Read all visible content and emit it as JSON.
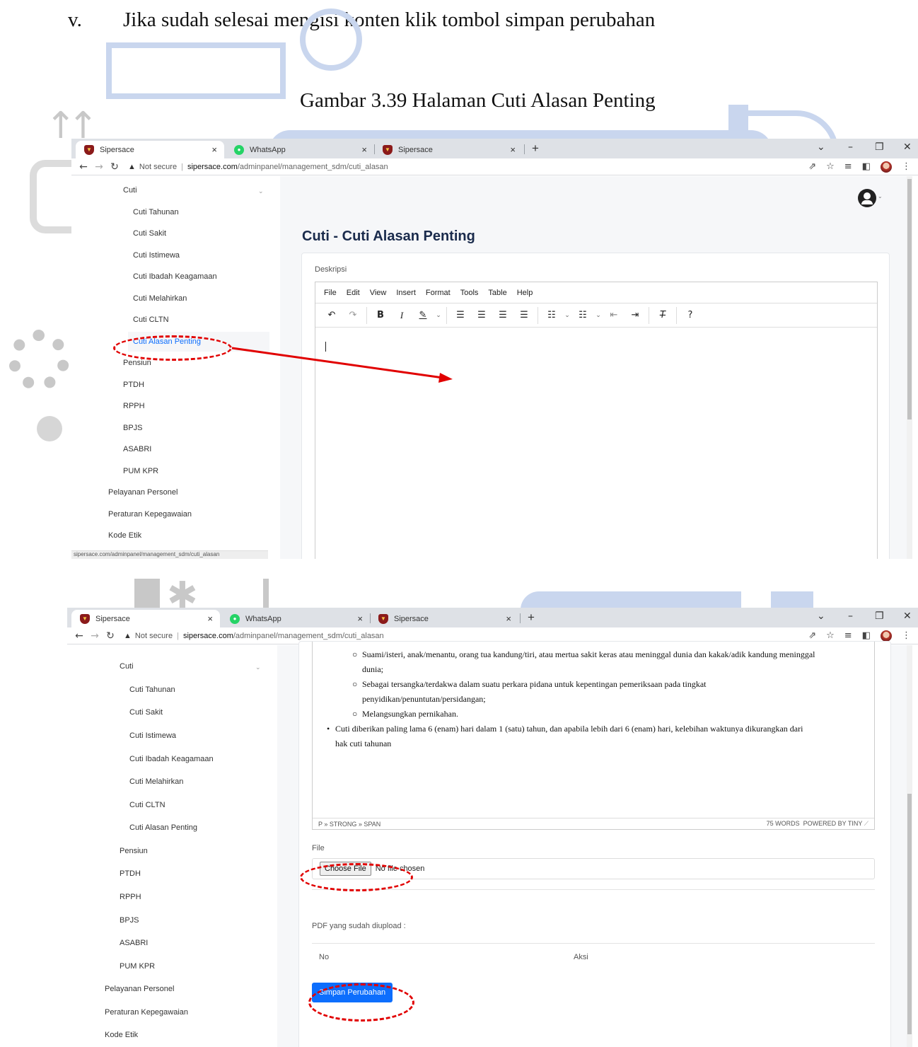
{
  "document": {
    "step_number": "v.",
    "step_text": "Jika sudah selesai mengisi konten klik tombol simpan perubahan",
    "caption": "Gambar 3.39 Halaman Cuti Alasan Penting"
  },
  "browser": {
    "tabs": [
      {
        "title": "Sipersace",
        "icon": "shield-icon"
      },
      {
        "title": "WhatsApp",
        "icon": "whatsapp-icon"
      },
      {
        "title": "Sipersace",
        "icon": "shield-icon"
      }
    ],
    "new_tab": "+",
    "close": "×",
    "not_secure": "Not secure",
    "url_host": "sipersace.com",
    "url_path": "/adminpanel/management_sdm/cuti_alasan",
    "status_url": "sipersace.com/adminpanel/management_sdm/cuti_alasan"
  },
  "sidebar": {
    "group": "Cuti",
    "sub_items": [
      "Cuti Tahunan",
      "Cuti Sakit",
      "Cuti Istimewa",
      "Cuti Ibadah Keagamaan",
      "Cuti Melahirkan",
      "Cuti CLTN",
      "Cuti Alasan Penting"
    ],
    "items": [
      "Pensiun",
      "PTDH",
      "RPPH",
      "BPJS",
      "ASABRI",
      "PUM KPR"
    ],
    "top_items": [
      "Pelayanan Personel",
      "Peraturan Kepegawaian",
      "Kode Etik"
    ]
  },
  "main": {
    "title": "Cuti - Cuti Alasan Penting",
    "desc_label": "Deskripsi",
    "menu": [
      "File",
      "Edit",
      "View",
      "Insert",
      "Format",
      "Tools",
      "Table",
      "Help"
    ]
  },
  "editor_content": {
    "bullet_1a": "Suami/isteri, anak/menantu, orang tua kandung/tiri, atau mertua sakit keras atau meninggal  dunia dan kakak/adik kandung meninggal",
    "bullet_1b": "dunia;",
    "bullet_2a": "Sebagai   tersangka/terdakwa   dalam   suatu   perkara   pidana   untuk   kepentingan   pemeriksaan   pada   tingkat",
    "bullet_2b": "penyidikan/penuntutan/persidangan;",
    "bullet_3": "Melangsungkan pernikahan.",
    "bullet_4a": "Cuti diberikan paling lama 6 (enam) hari dalam 1 (satu) tahun, dan apabila lebih dari 6 (enam) hari, kelebihan waktunya dikurangkan dari",
    "bullet_4b": "hak cuti tahunan",
    "path": "P » STRONG » SPAN",
    "word_count": "75 WORDS",
    "powered": "POWERED BY TINY"
  },
  "form": {
    "file_label": "File",
    "choose_file": "Choose File",
    "no_file": "No file chosen",
    "pdf_label": "PDF yang sudah diupload :",
    "col_no": "No",
    "col_aksi": "Aksi",
    "save_button": "Simpan Perubahan"
  },
  "colors": {
    "accent": "#0d6efd",
    "annotation": "#e10000",
    "title": "#1a2b4c"
  }
}
